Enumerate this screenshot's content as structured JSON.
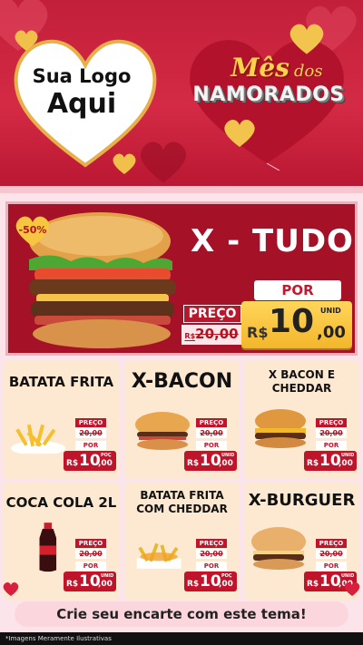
{
  "header": {
    "logo_line1": "Sua Logo",
    "logo_line2": "Aqui",
    "title_mes": "Mês",
    "title_dos": "dos",
    "title_namorados": "NAMORADOS"
  },
  "featured": {
    "badge": "-50%",
    "name": "X - TUDO",
    "preco_label": "PREÇO",
    "old_currency": "R$",
    "old_price": "20,00",
    "por_label": "POR",
    "currency": "R$",
    "price_int": "10",
    "price_cents": ",00",
    "unit": "UNID"
  },
  "products": [
    {
      "name": "BATATA FRITA",
      "preco_label": "PREÇO",
      "old_price": "20,00",
      "por_label": "POR",
      "currency": "R$",
      "price_int": "10",
      "price_cents": ",00",
      "unit": "POÇ"
    },
    {
      "name": "X-BACON",
      "preco_label": "PREÇO",
      "old_price": "20,00",
      "por_label": "POR",
      "currency": "R$",
      "price_int": "10",
      "price_cents": ",00",
      "unit": "UNID"
    },
    {
      "name": "X BACON E CHEDDAR",
      "preco_label": "PREÇO",
      "old_price": "20,00",
      "por_label": "POR",
      "currency": "R$",
      "price_int": "10",
      "price_cents": ",00",
      "unit": "UNID"
    },
    {
      "name": "COCA COLA 2L",
      "preco_label": "PREÇO",
      "old_price": "20,00",
      "por_label": "POR",
      "currency": "R$",
      "price_int": "10",
      "price_cents": ",00",
      "unit": "UNID"
    },
    {
      "name": "BATATA FRITA COM CHEDDAR",
      "preco_label": "PREÇO",
      "old_price": "20,00",
      "por_label": "POR",
      "currency": "R$",
      "price_int": "10",
      "price_cents": ",00",
      "unit": "POÇ"
    },
    {
      "name": "X-BURGUER",
      "preco_label": "PREÇO",
      "old_price": "20,00",
      "por_label": "POR",
      "currency": "R$",
      "price_int": "10",
      "price_cents": ",00",
      "unit": "UNID"
    }
  ],
  "cta": "Crie seu encarte com este tema!",
  "footnote": "*Imagens Meramente Ilustrativas",
  "colors": {
    "brand_red": "#c21f3a",
    "dark_red": "#a51127",
    "gold": "#ffd14d",
    "card_bg": "#fde9d2",
    "accent_pink": "#fbd6dd"
  }
}
